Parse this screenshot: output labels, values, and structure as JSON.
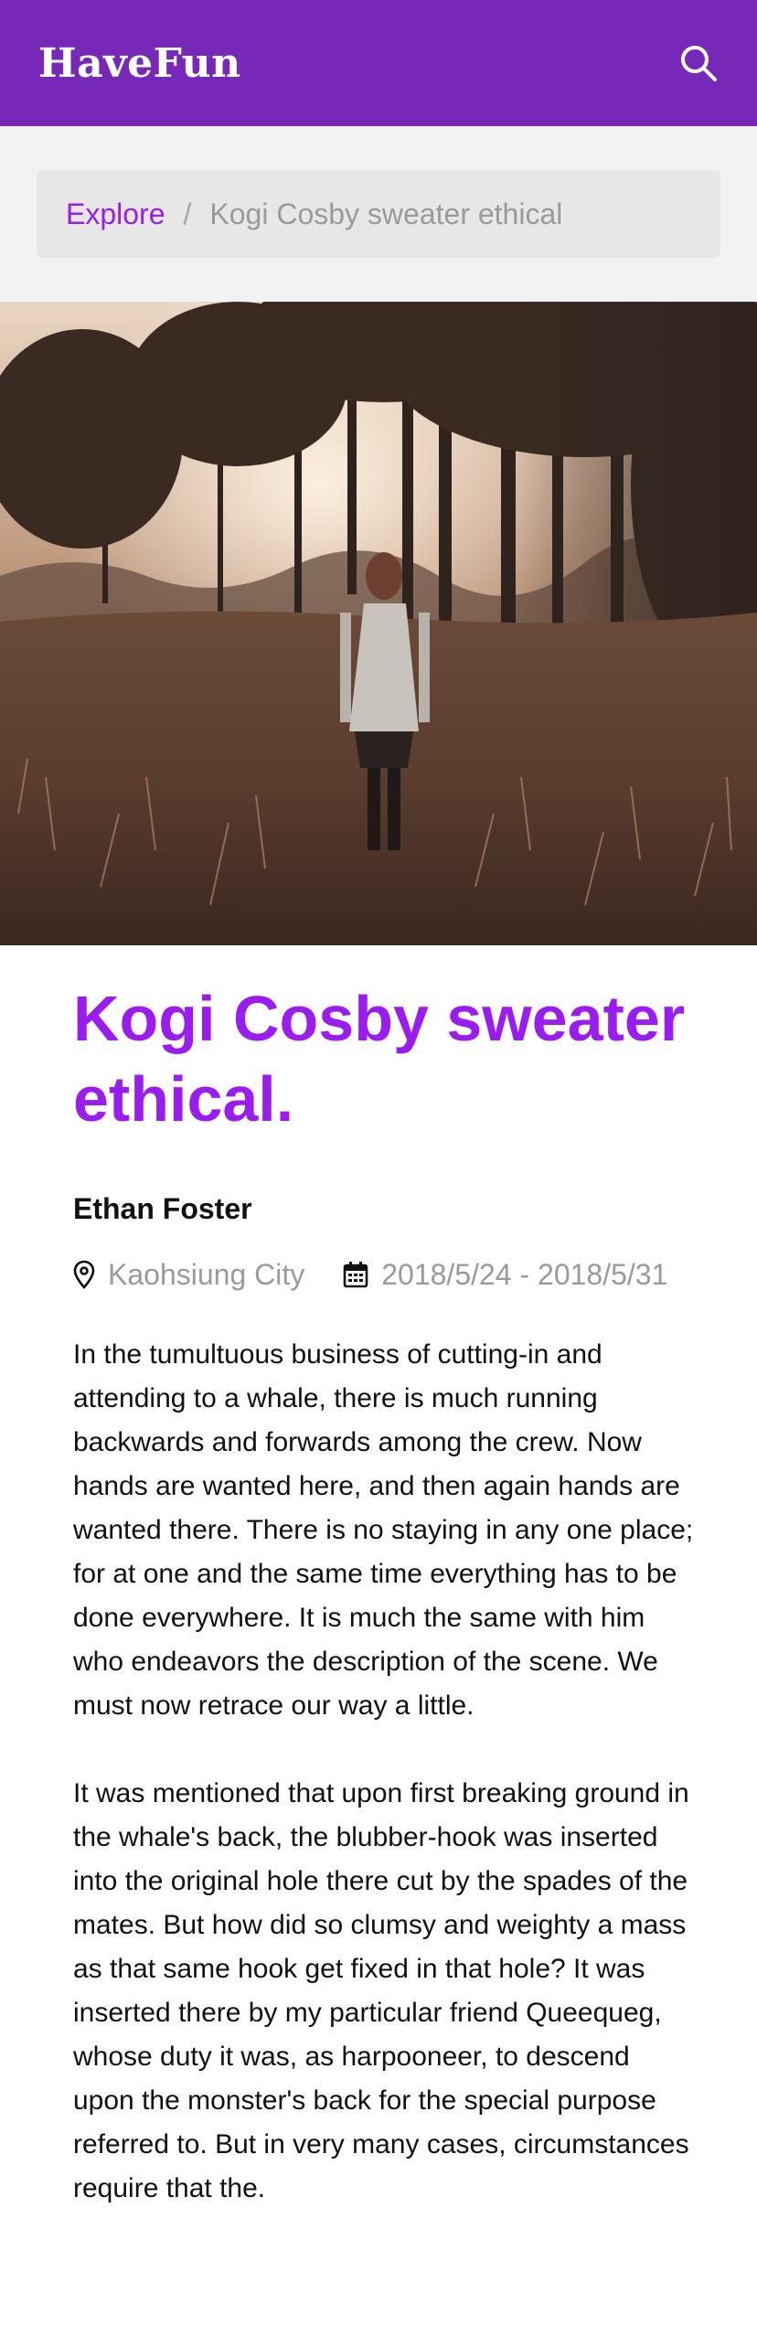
{
  "header": {
    "brand": "HaveFun",
    "search_icon": "search-icon"
  },
  "breadcrumb": {
    "parent": "Explore",
    "separator": "/",
    "current": "Kogi Cosby sweater ethical"
  },
  "hero": {
    "description_icon": "photo"
  },
  "article": {
    "title": "Kogi Cosby sweater ethical.",
    "author": "Ethan Foster",
    "location": "Kaohsiung City",
    "location_icon": "map-pin-icon",
    "date_range": "2018/5/24 - 2018/5/31",
    "date_icon": "calendar-icon",
    "paragraphs": [
      "In the tumultuous business of cutting-in and attending to a whale, there is much running backwards and forwards among the crew. Now hands are wanted here, and then again hands are wanted there. There is no staying in any one place; for at one and the same time everything has to be done everywhere. It is much the same with him who endeavors the description of the scene. We must now retrace our way a little.",
      "It was mentioned that upon first breaking ground in the whale's back, the blubber-hook was inserted into the original hole there cut by the spades of the mates. But how did so clumsy and weighty a mass as that same hook get fixed in that hole? It was inserted there by my particular friend Queequeg, whose duty it was, as harpooneer, to descend upon the monster's back for the special purpose referred to. But in very many cases, circumstances require that the."
    ]
  },
  "colors": {
    "header_bg": "#7828b8",
    "accent": "#9b1cf0",
    "muted_text": "#9a9a9a",
    "band_bg": "#f2f2f2"
  }
}
